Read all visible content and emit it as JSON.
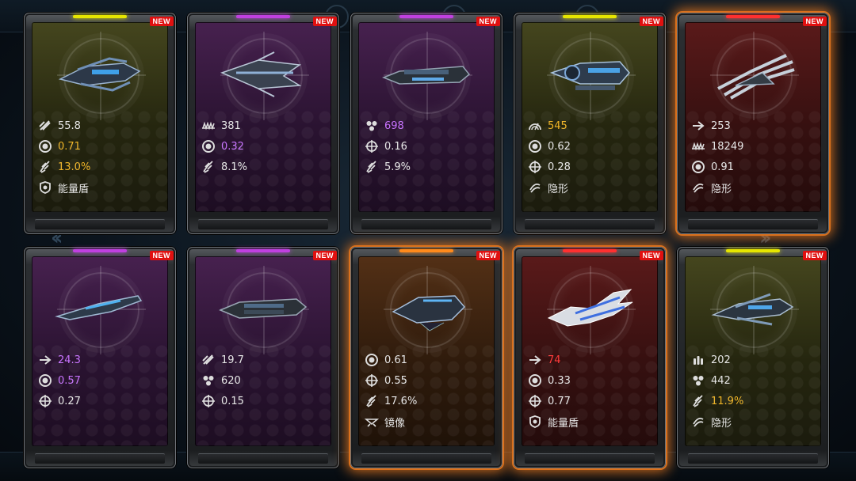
{
  "cards": [
    {
      "tier": "yellow",
      "badge": "NEW",
      "ship": "fighter-a",
      "glow": false,
      "stats": [
        {
          "icon": "speed-icon",
          "value": "55.8",
          "color": "white"
        },
        {
          "icon": "target-ring-icon",
          "value": "0.71",
          "color": "gold"
        },
        {
          "icon": "missile-icon",
          "value": "13.0%",
          "color": "gold"
        },
        {
          "icon": "shield-icon",
          "value": "能量盾",
          "color": "white"
        }
      ]
    },
    {
      "tier": "purple",
      "badge": "NEW",
      "ship": "fighter-b",
      "glow": false,
      "stats": [
        {
          "icon": "armor-icon",
          "value": "381",
          "color": "white"
        },
        {
          "icon": "target-ring-icon",
          "value": "0.32",
          "color": "purple"
        },
        {
          "icon": "missile-icon",
          "value": "8.1%",
          "color": "white"
        }
      ]
    },
    {
      "tier": "purple",
      "badge": "NEW",
      "ship": "cruiser-a",
      "glow": false,
      "stats": [
        {
          "icon": "cluster-icon",
          "value": "698",
          "color": "purple"
        },
        {
          "icon": "crosshair-icon",
          "value": "0.16",
          "color": "white"
        },
        {
          "icon": "missile-icon",
          "value": "5.9%",
          "color": "white"
        }
      ]
    },
    {
      "tier": "yellow",
      "badge": "NEW",
      "ship": "gunship-a",
      "glow": false,
      "stats": [
        {
          "icon": "radar-icon",
          "value": "545",
          "color": "gold"
        },
        {
          "icon": "target-ring-icon",
          "value": "0.62",
          "color": "white"
        },
        {
          "icon": "crosshair-icon",
          "value": "0.28",
          "color": "white"
        },
        {
          "icon": "stealth-icon",
          "value": "隐形",
          "color": "white"
        }
      ]
    },
    {
      "tier": "red",
      "badge": "NEW",
      "ship": "spike-a",
      "glow": true,
      "stats": [
        {
          "icon": "arrow-icon",
          "value": "253",
          "color": "white"
        },
        {
          "icon": "armor-icon",
          "value": "18249",
          "color": "white"
        },
        {
          "icon": "target-ring-icon",
          "value": "0.91",
          "color": "white"
        },
        {
          "icon": "stealth-icon",
          "value": "隐形",
          "color": "white"
        }
      ]
    },
    {
      "tier": "purple",
      "badge": "NEW",
      "ship": "interceptor-a",
      "glow": false,
      "stats": [
        {
          "icon": "arrow-icon",
          "value": "24.3",
          "color": "purple"
        },
        {
          "icon": "target-ring-icon",
          "value": "0.57",
          "color": "purple"
        },
        {
          "icon": "crosshair-icon",
          "value": "0.27",
          "color": "white"
        }
      ]
    },
    {
      "tier": "purple",
      "badge": "NEW",
      "ship": "cruiser-b",
      "glow": false,
      "stats": [
        {
          "icon": "speed-icon",
          "value": "19.7",
          "color": "white"
        },
        {
          "icon": "cluster-icon",
          "value": "620",
          "color": "white"
        },
        {
          "icon": "crosshair-icon",
          "value": "0.15",
          "color": "white"
        }
      ]
    },
    {
      "tier": "orange",
      "badge": "NEW",
      "ship": "bomber-a",
      "glow": true,
      "stats": [
        {
          "icon": "target-ring-icon",
          "value": "0.61",
          "color": "white"
        },
        {
          "icon": "crosshair-icon",
          "value": "0.55",
          "color": "white"
        },
        {
          "icon": "missile-icon",
          "value": "17.6%",
          "color": "white"
        },
        {
          "icon": "mirror-icon",
          "value": "镜像",
          "color": "white"
        }
      ]
    },
    {
      "tier": "red",
      "badge": "NEW",
      "ship": "blade-a",
      "glow": true,
      "stats": [
        {
          "icon": "arrow-icon",
          "value": "74",
          "color": "red"
        },
        {
          "icon": "target-ring-icon",
          "value": "0.33",
          "color": "white"
        },
        {
          "icon": "crosshair-icon",
          "value": "0.77",
          "color": "white"
        },
        {
          "icon": "shield-icon",
          "value": "能量盾",
          "color": "white"
        }
      ]
    },
    {
      "tier": "yellow",
      "badge": "NEW",
      "ship": "fighter-c",
      "glow": false,
      "stats": [
        {
          "icon": "ammo-icon",
          "value": "202",
          "color": "white"
        },
        {
          "icon": "cluster-icon",
          "value": "442",
          "color": "white"
        },
        {
          "icon": "missile-icon",
          "value": "11.9%",
          "color": "gold"
        },
        {
          "icon": "stealth-icon",
          "value": "隐形",
          "color": "white"
        }
      ]
    }
  ]
}
